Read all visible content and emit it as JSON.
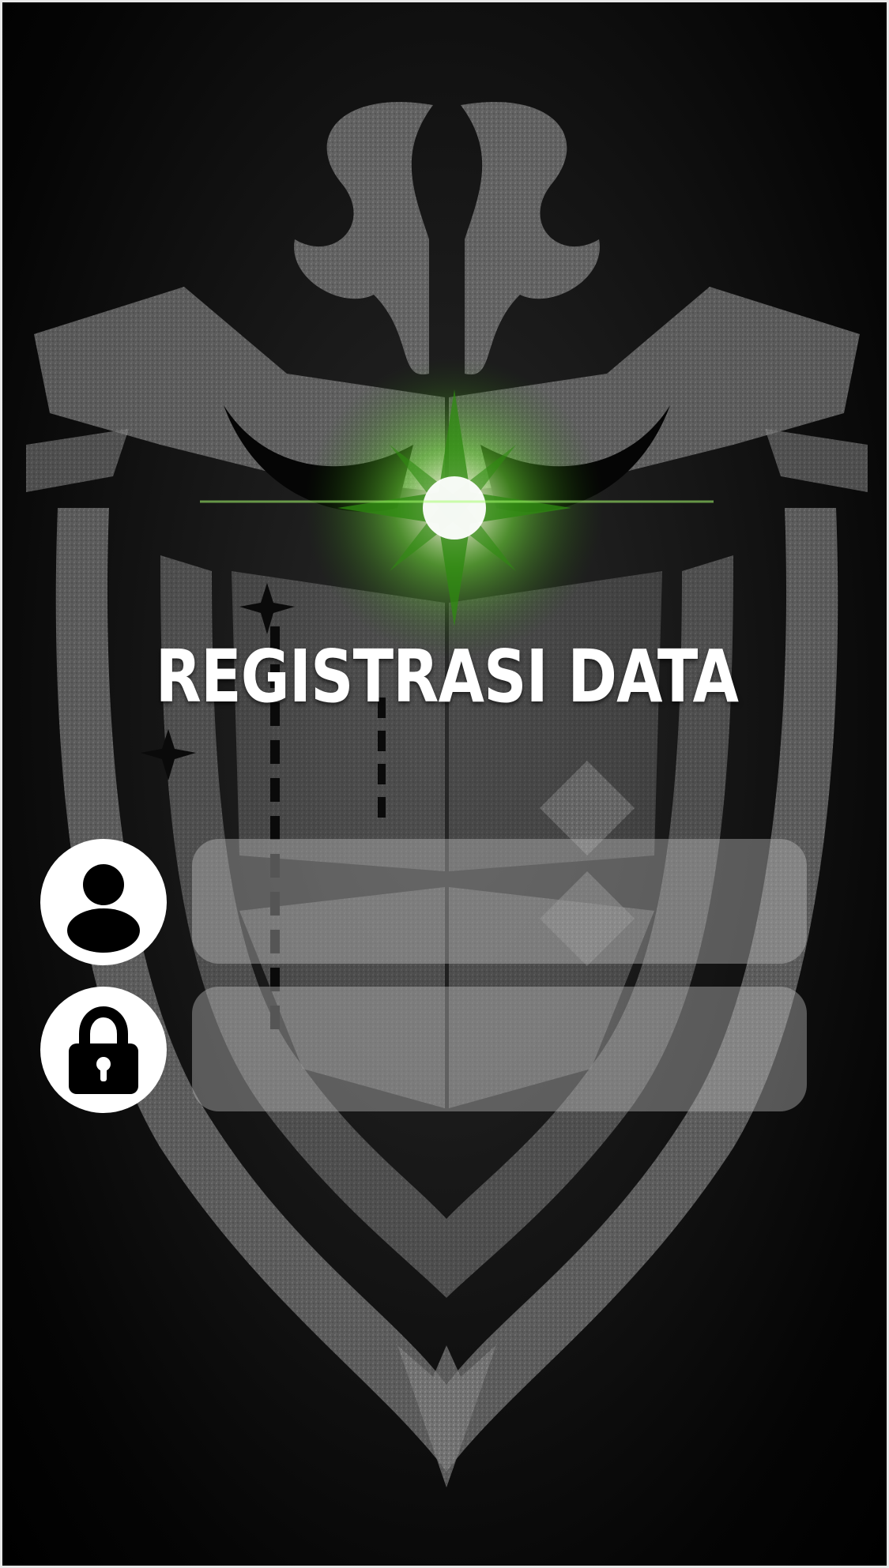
{
  "screen": {
    "title": "REGISTRASI DATA"
  },
  "form": {
    "username": {
      "icon": "user-icon",
      "value": "",
      "placeholder": ""
    },
    "password": {
      "icon": "lock-icon",
      "value": "",
      "placeholder": ""
    }
  },
  "theme": {
    "background": "#000000",
    "emblem_color": "#8a8a8a",
    "glow_color": "#7cff3a",
    "field_color": "#bebebe",
    "icon_color": "#ffffff"
  }
}
